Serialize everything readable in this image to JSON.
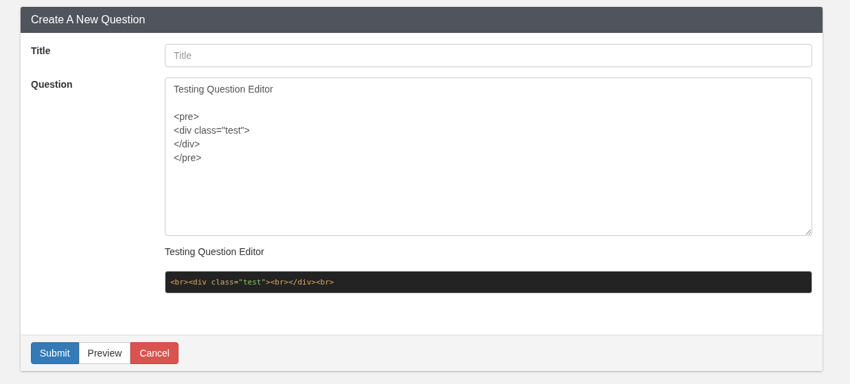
{
  "panel": {
    "title": "Create A New Question"
  },
  "fields": [
    {
      "kind": "input",
      "label": "Title",
      "placeholder": "Title"
    },
    {
      "kind": "textarea",
      "label": "Question",
      "value": "Testing Question Editor\n\n<pre>\n<div class=\"test\">\n</div>\n</pre>"
    }
  ],
  "preview": {
    "text": "Testing Question Editor",
    "code_tokens": [
      {
        "kind": "tag",
        "text": "<br><div "
      },
      {
        "kind": "attr",
        "text": "class="
      },
      {
        "kind": "string",
        "text": "\"test\""
      },
      {
        "kind": "tag",
        "text": "><br></div><br>"
      }
    ]
  },
  "buttons": [
    {
      "kind": "primary",
      "label": "Submit"
    },
    {
      "kind": "default",
      "label": "Preview"
    },
    {
      "kind": "danger",
      "label": "Cancel"
    }
  ]
}
